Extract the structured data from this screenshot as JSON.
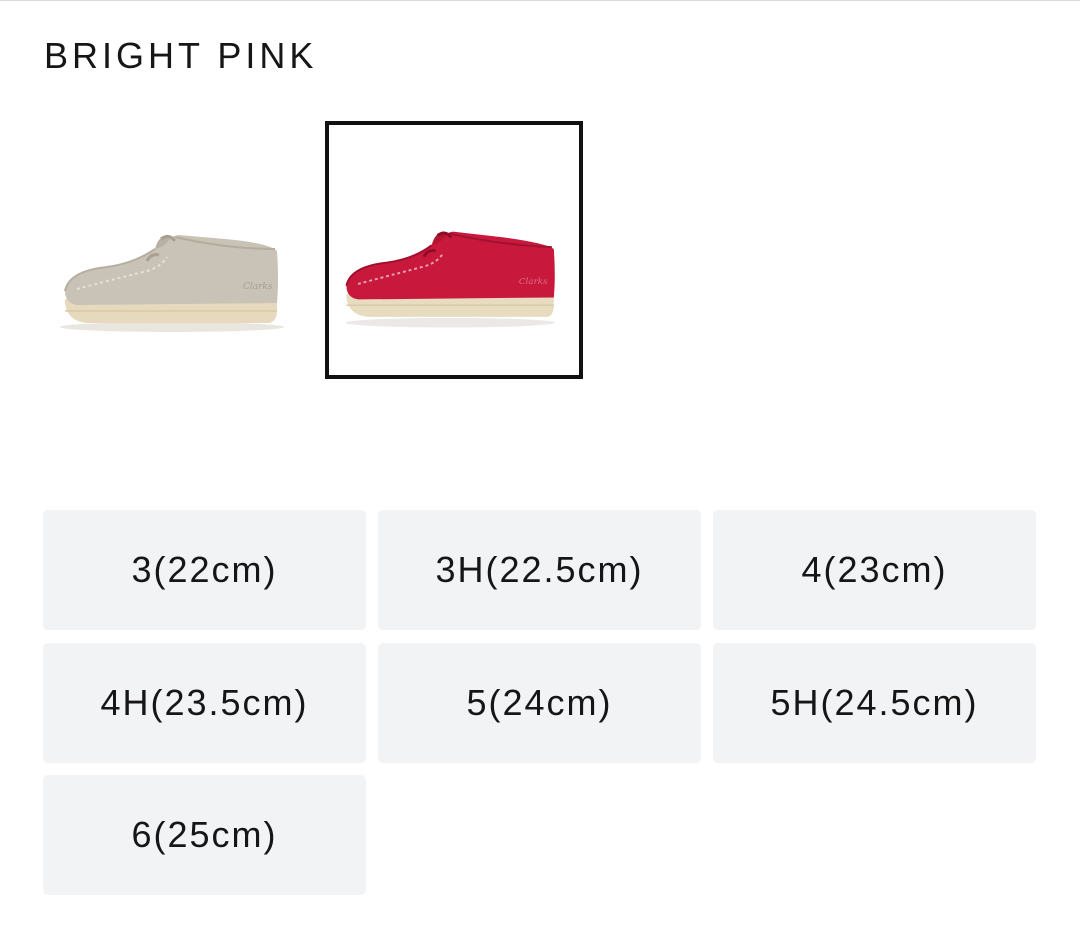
{
  "product": {
    "selected_color": "BRIGHT PINK",
    "color_swatches": [
      {
        "icon": "sand-suede-shoe-image",
        "color": "#c9c2b6",
        "selected": false
      },
      {
        "icon": "bright-pink-suede-shoe-image",
        "color": "#c8183c",
        "selected": true
      }
    ],
    "sizes": [
      {
        "label": "3(22cm)"
      },
      {
        "label": "3H(22.5cm)"
      },
      {
        "label": "4(23cm)"
      },
      {
        "label": "4H(23.5cm)"
      },
      {
        "label": "5(24cm)"
      },
      {
        "label": "5H(24.5cm)"
      },
      {
        "label": "6(25cm)"
      }
    ]
  },
  "colors": {
    "size_button_bg": "#f2f3f5",
    "selected_border": "#111111",
    "text": "#161616",
    "sole": "#e8dcc0"
  }
}
